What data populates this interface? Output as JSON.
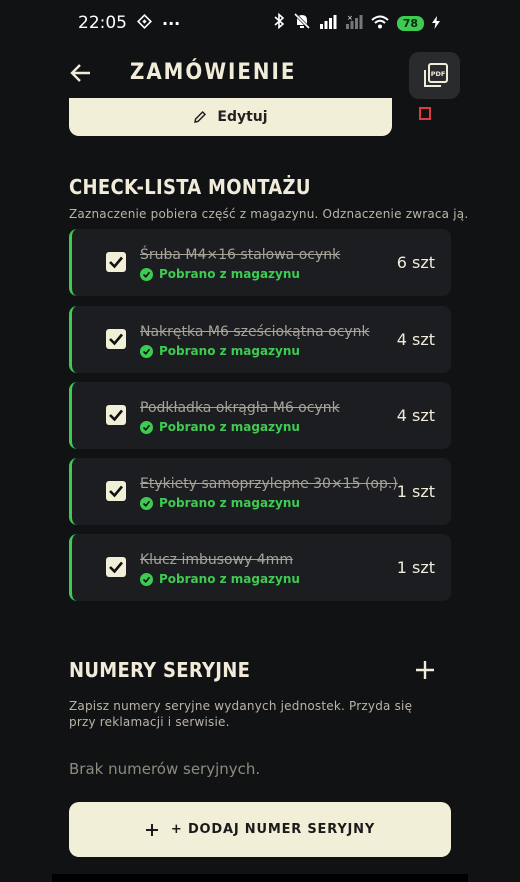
{
  "status_bar": {
    "time": "22:05",
    "dots": "···",
    "battery": "78"
  },
  "header": {
    "title": "ZAMÓWIENIE",
    "pdf_label": "PDF"
  },
  "edit_card": {
    "label": "Edytuj"
  },
  "checklist": {
    "title": "CHECK-LISTA MONTAŻU",
    "description": "Zaznaczenie pobiera część z magazynu. Odznaczenie zwraca ją.",
    "items": [
      {
        "name": "Śruba M4×16 stalowa ocynk",
        "status": "Pobrano z magazynu",
        "qty": "6 szt"
      },
      {
        "name": "Nakrętka M6 sześciokątna ocynk",
        "status": "Pobrano z magazynu",
        "qty": "4 szt"
      },
      {
        "name": "Podkładka okrągła M6 ocynk",
        "status": "Pobrano z magazynu",
        "qty": "4 szt"
      },
      {
        "name": "Etykiety samoprzylepne 30×15 (op.)",
        "status": "Pobrano z magazynu",
        "qty": "1 szt"
      },
      {
        "name": "Klucz imbusowy 4mm",
        "status": "Pobrano z magazynu",
        "qty": "1 szt"
      }
    ]
  },
  "serials": {
    "title": "NUMERY SERYJNE",
    "description": "Zapisz numery seryjne wydanych jednostek. Przyda się przy reklamacji i serwisie.",
    "empty": "Brak numerów seryjnych.",
    "add_button": "+ DODAJ NUMER SERYJNY"
  },
  "colors": {
    "accent_green": "#3ecb52",
    "cream": "#f2efd8",
    "danger": "#e0393e",
    "background": "#111214"
  }
}
